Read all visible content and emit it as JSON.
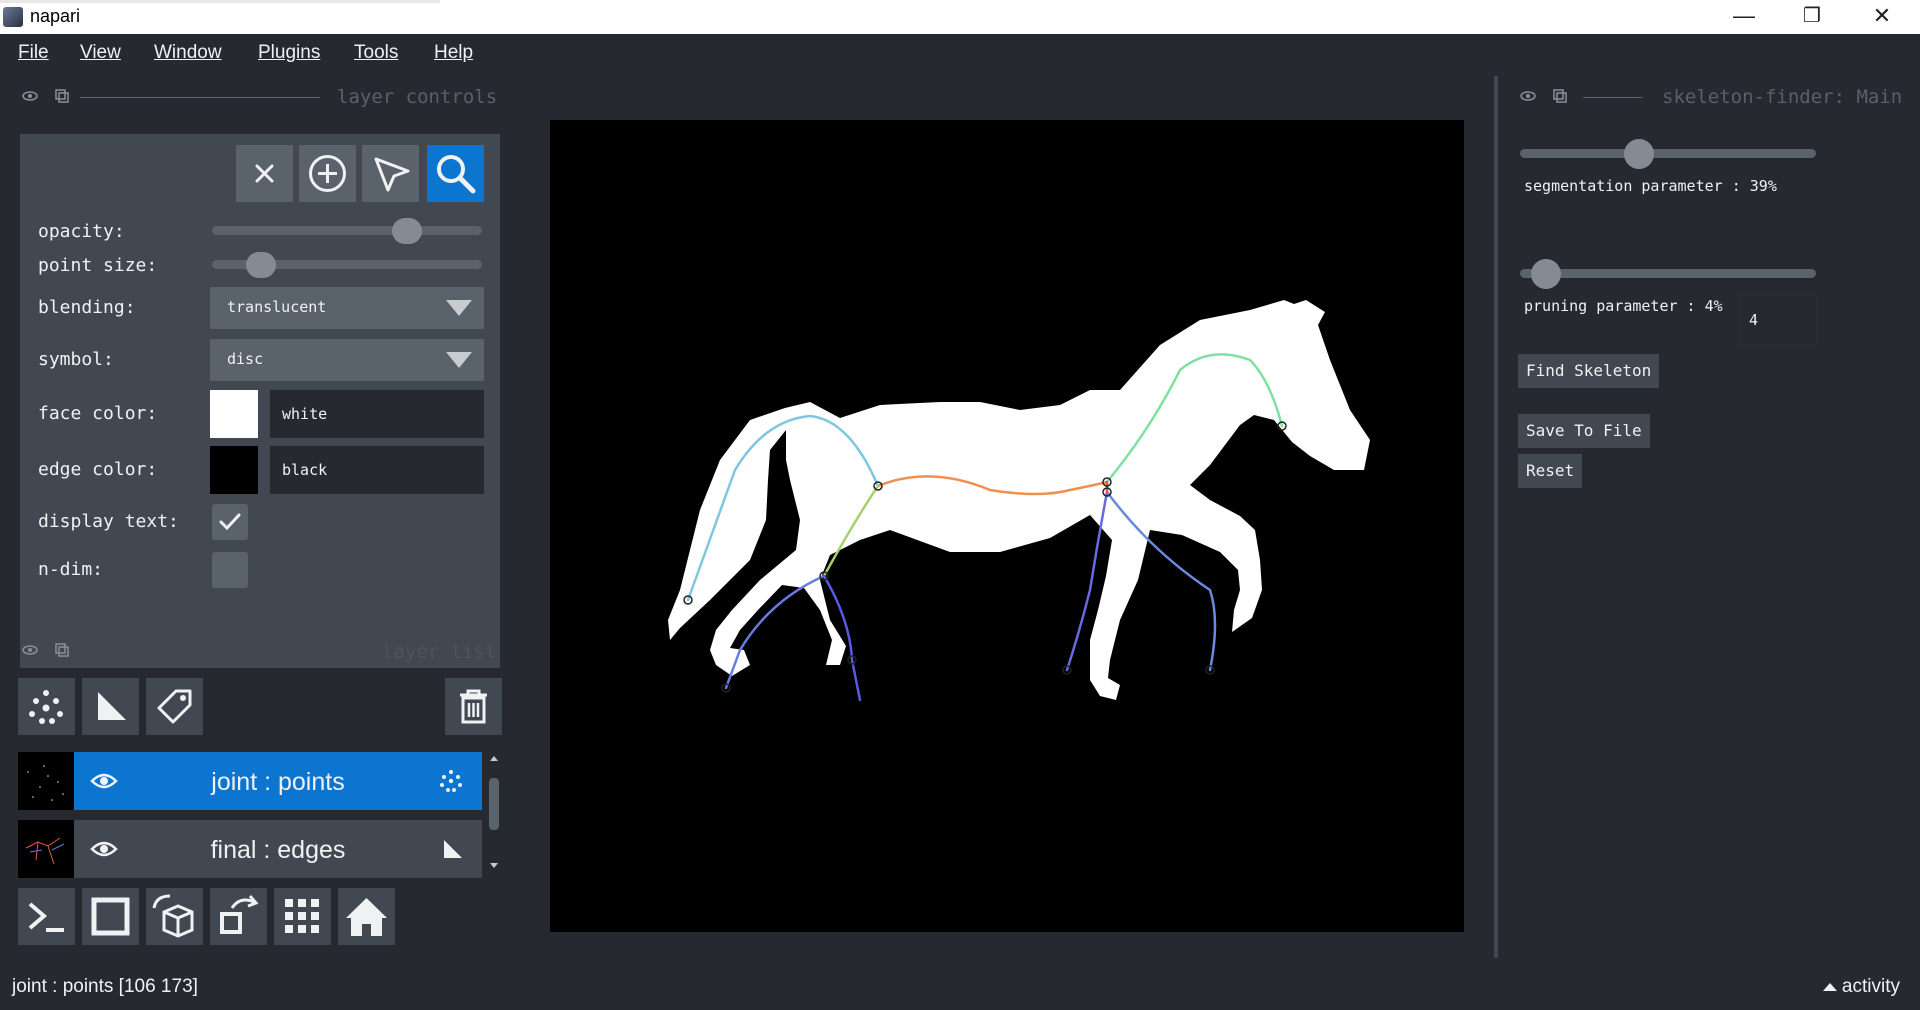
{
  "window": {
    "title": "napari",
    "minimize": "—",
    "restore": "❐",
    "close": "✕"
  },
  "menu": [
    "File",
    "View",
    "Window",
    "Plugins",
    "Tools",
    "Help"
  ],
  "left_panel": {
    "header": "layer controls",
    "controls": {
      "opacity_label": "opacity:",
      "opacity_value": 0.75,
      "point_size_label": "point size:",
      "point_size_value": 0.14,
      "blending_label": "blending:",
      "blending_value": "translucent",
      "symbol_label": "symbol:",
      "symbol_value": "disc",
      "face_color_label": "face color:",
      "face_color_value": "white",
      "face_color_hex": "#ffffff",
      "edge_color_label": "edge color:",
      "edge_color_value": "black",
      "edge_color_hex": "#000000",
      "display_text_label": "display text:",
      "display_text_checked": true,
      "ndim_label": "n-dim:",
      "ndim_checked": false
    },
    "tools": [
      "delete-selected",
      "add-points",
      "select-points",
      "pan-zoom"
    ],
    "active_tool": "pan-zoom",
    "layer_list_header": "layer list",
    "layers": [
      {
        "name": "joint : points",
        "type": "points",
        "selected": true,
        "visible": true
      },
      {
        "name": "final : edges",
        "type": "shapes",
        "selected": false,
        "visible": true
      }
    ]
  },
  "right_panel": {
    "header": "skeleton-finder: Main",
    "segmentation_label": "segmentation parameter : 39%",
    "segmentation_value": 0.39,
    "pruning_label": "pruning parameter : 4%",
    "pruning_value": 0.04,
    "pruning_spin_value": "4",
    "find_button": "Find Skeleton",
    "save_button": "Save To File",
    "reset_button": "Reset"
  },
  "status": {
    "text": "joint : points [106 173]",
    "activity": "activity"
  },
  "colors": {
    "accent": "#0b75d0",
    "bg": "#262930",
    "panel": "#414851",
    "control": "#5a626c"
  }
}
